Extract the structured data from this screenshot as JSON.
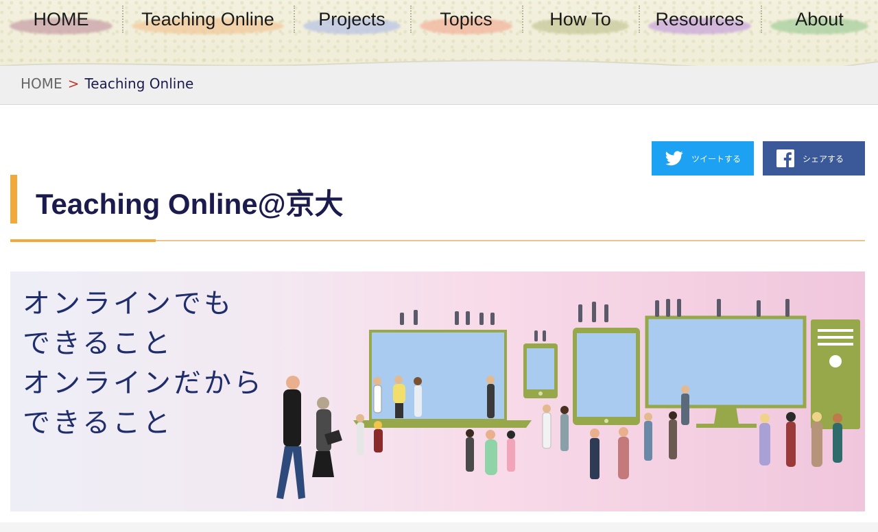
{
  "nav": {
    "items": [
      {
        "label": "HOME",
        "brush": "#c9a0a8"
      },
      {
        "label": "Teaching Online",
        "brush": "#f2c99a"
      },
      {
        "label": "Projects",
        "brush": "#b9c4e4"
      },
      {
        "label": "Topics",
        "brush": "#f3b39b"
      },
      {
        "label": "How To",
        "brush": "#c8c99a"
      },
      {
        "label": "Resources",
        "brush": "#c9a6dd"
      },
      {
        "label": "About",
        "brush": "#a7cf9c"
      }
    ]
  },
  "breadcrumb": {
    "home": "HOME",
    "separator": ">",
    "current": "Teaching Online"
  },
  "share": {
    "twitter_label": "ツイートする",
    "facebook_label": "シェアする",
    "twitter_icon": "twitter-bird-icon",
    "facebook_icon": "facebook-f-icon"
  },
  "page": {
    "title": "Teaching Online@京大"
  },
  "hero": {
    "lines": [
      "オンラインでも",
      "できること",
      "オンラインだから",
      "できること"
    ]
  },
  "colors": {
    "accent": "#f0a93a",
    "title_text": "#1b1b4d",
    "twitter": "#1da1f2",
    "facebook": "#3b5998",
    "device_frame": "#97a84a",
    "device_screen": "#a9cbef"
  }
}
